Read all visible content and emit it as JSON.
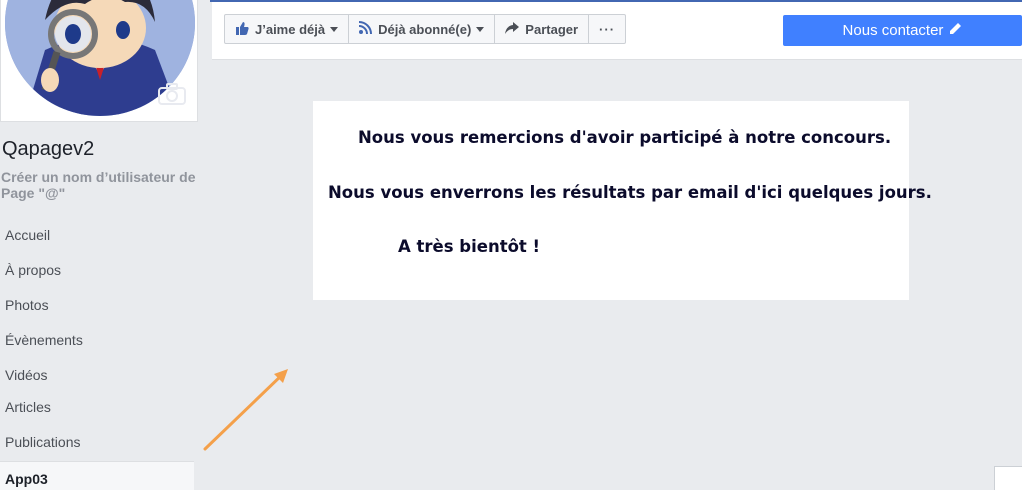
{
  "sidebar": {
    "page_name": "Qapagev2",
    "create_username": "Créer un nom d’utilisateur de Page \"@\"",
    "items": [
      {
        "label": "Accueil"
      },
      {
        "label": "À propos"
      },
      {
        "label": "Photos"
      },
      {
        "label": "Évènements"
      },
      {
        "label": "Vidéos"
      },
      {
        "label": "Articles"
      },
      {
        "label": "Publications"
      },
      {
        "label": "App03"
      }
    ],
    "active_item": "App03"
  },
  "actionbar": {
    "like_label": "J’aime déjà",
    "follow_label": "Déjà abonné(e)",
    "share_label": "Partager",
    "more_label": "···",
    "contact_label": "Nous contacter"
  },
  "message": {
    "line1": "Nous vous remercions d'avoir participé à notre concours.",
    "line2": "Nous vous enverrons les résultats par email d'ici quelques jours.",
    "line3": "A très bientôt !"
  },
  "colors": {
    "accent": "#4080ff",
    "facebook_blue": "#4267b2",
    "background": "#e9ebee",
    "annotation_arrow": "#f4a04a"
  }
}
